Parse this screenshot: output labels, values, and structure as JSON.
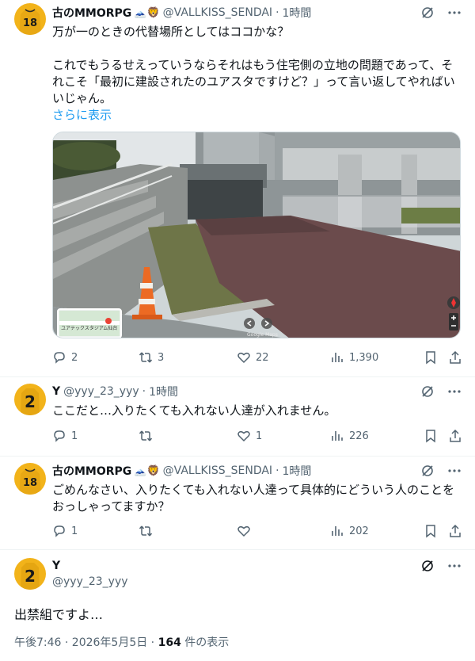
{
  "tweets": [
    {
      "author": "古のMMORPG",
      "badge": "🗻🦁",
      "handle": "@VALLKISS_SENDAI",
      "time": "1時間",
      "text_lines": [
        "万が一のときの代替場所としてはココかな？",
        "",
        "これでもうるせえっていうならそれはもう住宅側の立地の問題であって、そ",
        "れこそ「最初に建設されたのユアスタですけど？」って言い返してやればい",
        "いじゃん。"
      ],
      "show_more": "さらに表示",
      "map_label": "ユアテックスタジアム仙台",
      "map_watermark": "Google Maps",
      "replies": "2",
      "reposts": "3",
      "likes": "22",
      "views": "1,390"
    },
    {
      "author": "Y",
      "handle": "@yyy_23_yyy",
      "time": "1時間",
      "text": "ここだと…入りたくても入れない人達が入れません。",
      "replies": "1",
      "reposts": "",
      "likes": "1",
      "views": "226"
    },
    {
      "author": "古のMMORPG",
      "badge": "🗻🦁",
      "handle": "@VALLKISS_SENDAI",
      "time": "1時間",
      "text_lines": [
        "ごめんなさい、入りたくても入れない人達って具体的にどういう人のことを",
        "おっしゃってますか？"
      ],
      "replies": "1",
      "reposts": "",
      "likes": "",
      "views": "202"
    }
  ],
  "main": {
    "author": "Y",
    "handle": "@yyy_23_yyy",
    "text": "出禁組ですよ…",
    "timestamp": "午後7:46 · 2026年5月5日 · ",
    "views_count": "164",
    "views_label": " 件の表示"
  },
  "colors": {
    "accent": "#1d9bf0",
    "muted": "#536471",
    "text": "#0f1419",
    "jersey_yellow": "#f2b31a"
  },
  "icons": [
    "reply-icon",
    "repost-icon",
    "like-icon",
    "views-icon",
    "bookmark-icon",
    "share-icon",
    "grok-icon",
    "more-icon"
  ]
}
